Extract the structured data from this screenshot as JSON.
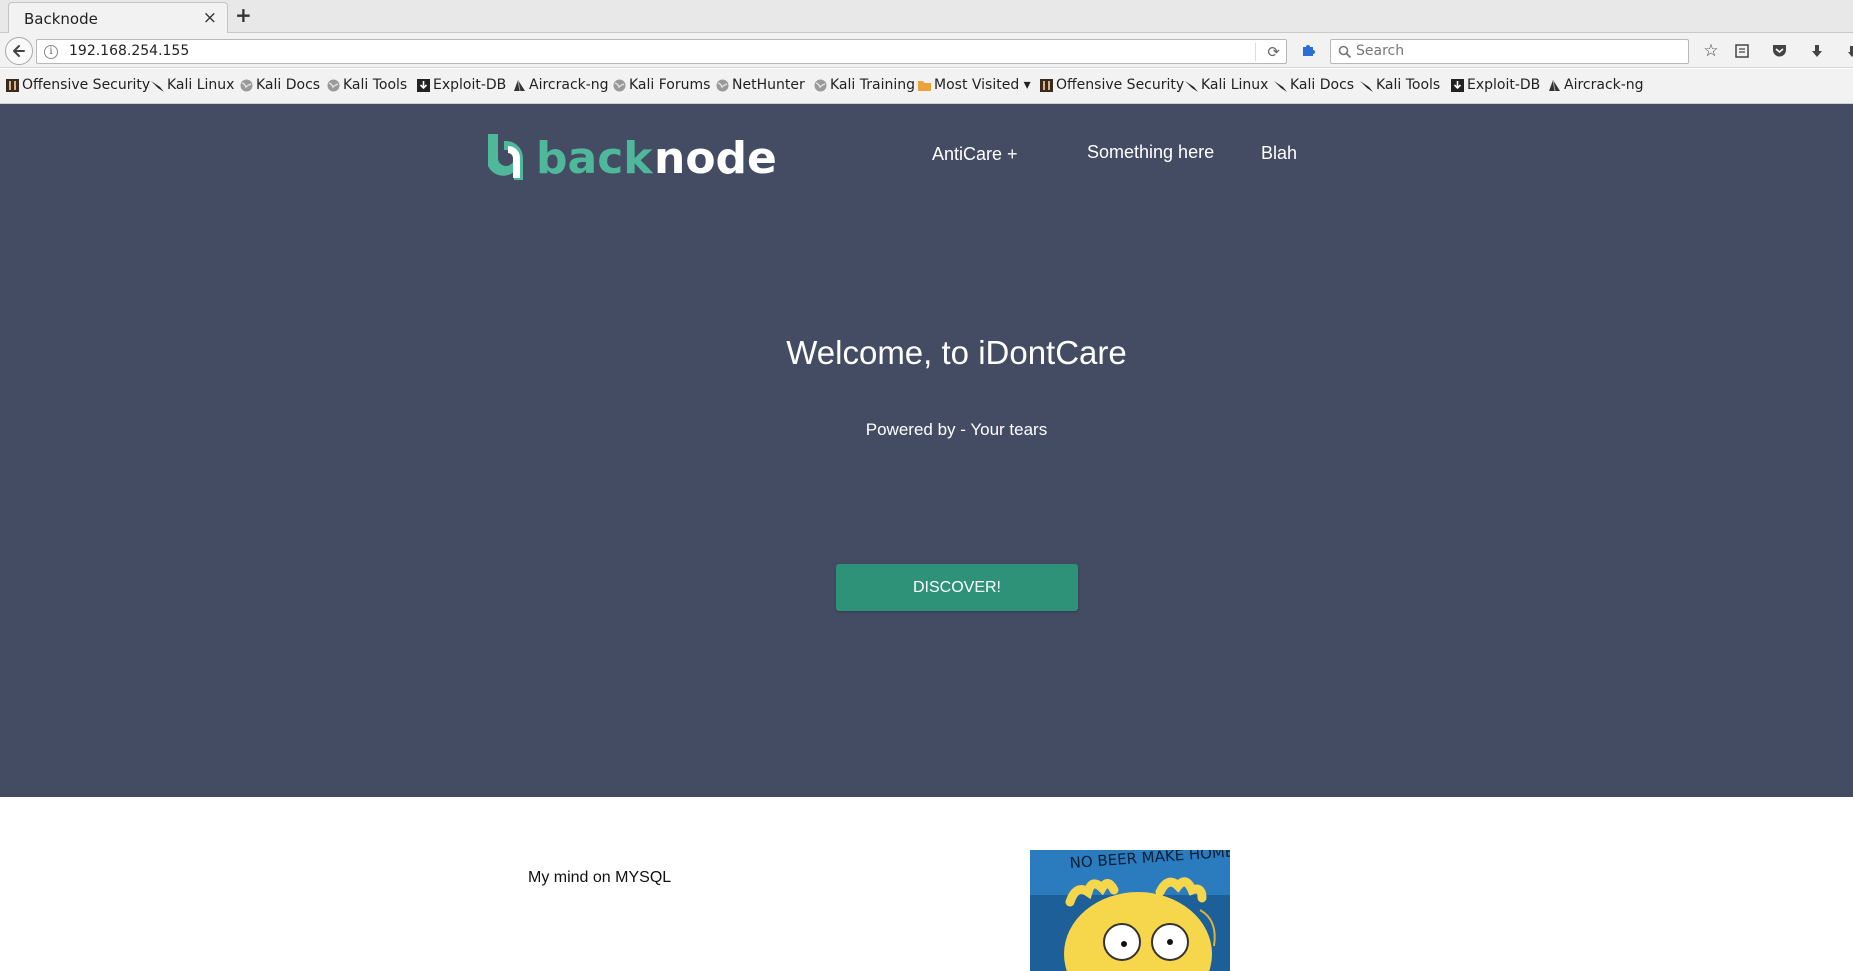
{
  "browser": {
    "tab_title": "Backnode",
    "tab_close": "×",
    "new_tab": "+",
    "url": "192.168.254.155",
    "search_placeholder": "Search"
  },
  "bookmarks": [
    {
      "label": "Offensive Security",
      "icon": "offsec-icon"
    },
    {
      "label": "Kali Linux",
      "icon": "kali-icon"
    },
    {
      "label": "Kali Docs",
      "icon": "globe-icon"
    },
    {
      "label": "Kali Tools",
      "icon": "globe-icon"
    },
    {
      "label": "Exploit-DB",
      "icon": "exploitdb-icon"
    },
    {
      "label": "Aircrack-ng",
      "icon": "aircrack-icon"
    },
    {
      "label": "Kali Forums",
      "icon": "globe-icon"
    },
    {
      "label": "NetHunter",
      "icon": "globe-icon"
    },
    {
      "label": "Kali Training",
      "icon": "globe-icon"
    },
    {
      "label": "Most Visited ▾",
      "icon": "folder-icon"
    },
    {
      "label": "Offensive Security",
      "icon": "offsec-icon"
    },
    {
      "label": "Kali Linux",
      "icon": "kali-icon"
    },
    {
      "label": "Kali Docs",
      "icon": "kali-icon"
    },
    {
      "label": "Kali Tools",
      "icon": "kali-icon"
    },
    {
      "label": "Exploit-DB",
      "icon": "exploitdb-icon"
    },
    {
      "label": "Aircrack-ng",
      "icon": "aircrack-icon"
    }
  ],
  "site": {
    "logo_back": "back",
    "logo_node": "node",
    "nav": [
      "AntiCare +",
      "Something here",
      "Blah"
    ],
    "welcome": "Welcome, to iDontCare",
    "powered": "Powered by - Your tears",
    "cta": "DISCOVER!",
    "section_text": "My mind on MYSQL",
    "meme_text": "NO BEER MAKE HOMER"
  },
  "colors": {
    "hero_bg": "#434c63",
    "accent": "#4fb89a",
    "button": "#2e9279"
  }
}
